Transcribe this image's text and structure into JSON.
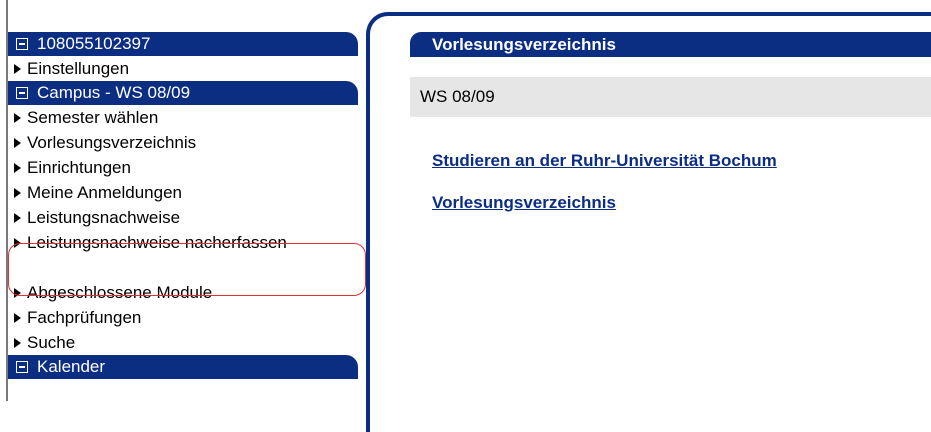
{
  "sidebar": {
    "account_header": "108055102397",
    "account_items": [
      "Einstellungen"
    ],
    "campus_header": "Campus - WS 08/09",
    "campus_items": [
      "Semester wählen",
      "Vorlesungsverzeichnis",
      "Einrichtungen",
      "Meine Anmeldungen",
      "Leistungsnachweise",
      "Leistungsnachweise nacherfassen",
      "Abgeschlossene Module",
      "Fachprüfungen",
      "Suche"
    ],
    "calendar_header": "Kalender"
  },
  "main": {
    "title": "Vorlesungsverzeichnis",
    "semester": "WS 08/09",
    "links": [
      "Studieren an der Ruhr-Universität Bochum",
      "Vorlesungsverzeichnis"
    ]
  },
  "colors": {
    "navy": "#0b2e82",
    "highlight_circle": "#e23030",
    "semester_box_bg": "#e6e6e6"
  }
}
